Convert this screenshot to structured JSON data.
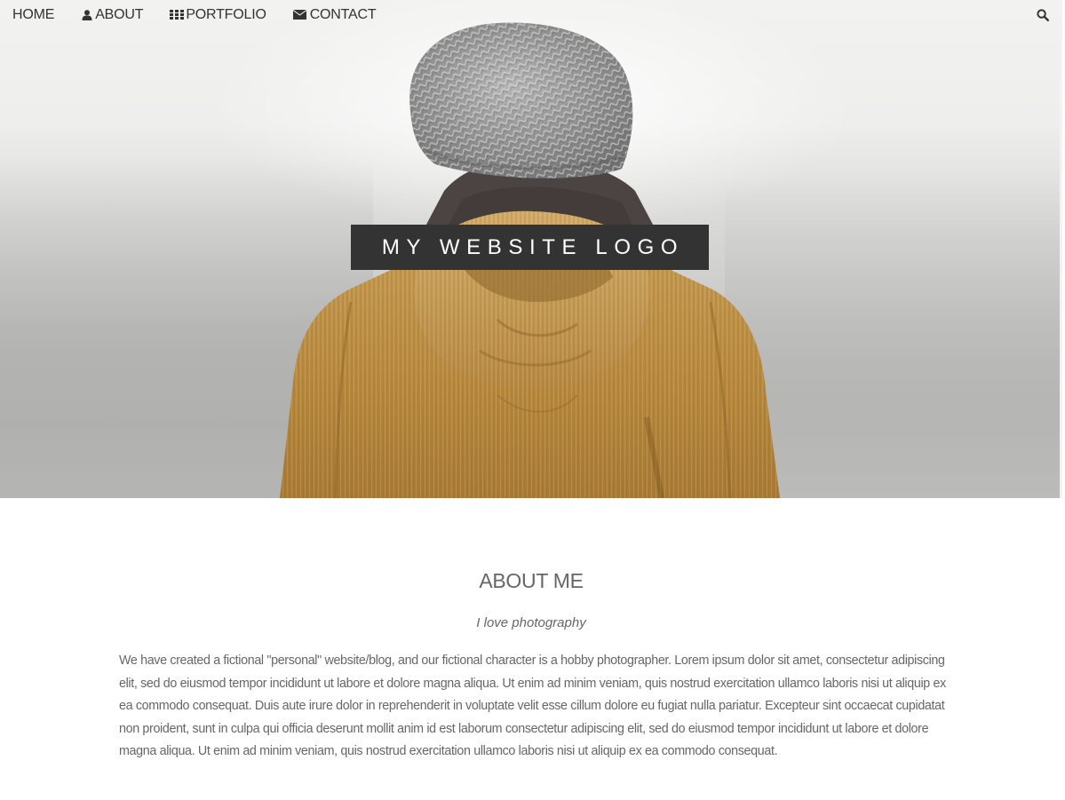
{
  "nav": {
    "items": [
      {
        "label": "HOME",
        "icon": ""
      },
      {
        "label": "ABOUT",
        "icon": "user-icon"
      },
      {
        "label": "PORTFOLIO",
        "icon": "grid-icon"
      },
      {
        "label": "CONTACT",
        "icon": "envelope-icon"
      }
    ],
    "search_icon": "search-icon"
  },
  "hero": {
    "logo_text": "MY WEBSITE LOGO"
  },
  "about": {
    "title": "ABOUT ME",
    "subtitle": "I love photography",
    "body": "We have created a fictional \"personal\" website/blog, and our fictional character is a hobby photographer. Lorem ipsum dolor sit amet, consectetur adipiscing elit, sed do eiusmod tempor incididunt ut labore et dolore magna aliqua. Ut enim ad minim veniam, quis nostrud exercitation ullamco laboris nisi ut aliquip ex ea commodo consequat. Duis aute irure dolor in reprehenderit in voluptate velit esse cillum dolore eu fugiat nulla pariatur. Excepteur sint occaecat cupidatat non proident, sunt in culpa qui officia deserunt mollit anim id est laborum consectetur adipiscing elit, sed do eiusmod tempor incididunt ut labore et dolore magna aliqua. Ut enim ad minim veniam, quis nostrud exercitation ullamco laboris nisi ut aliquip ex ea commodo consequat."
  },
  "colors": {
    "logo_bg": "#333333",
    "jacket": "#b8893f",
    "beanie": "#8e8e8e",
    "text": "#666666"
  }
}
